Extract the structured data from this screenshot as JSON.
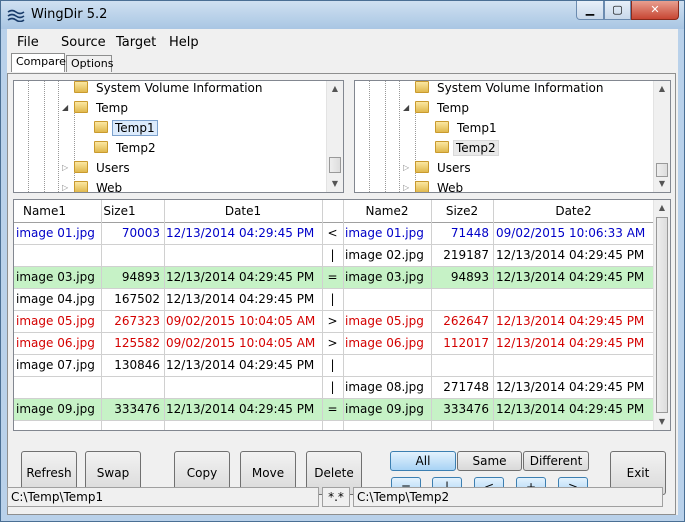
{
  "window": {
    "title": "WingDir 5.2"
  },
  "menu": [
    "File",
    "Source",
    "Target",
    "Help"
  ],
  "tabs": {
    "compare": "Compare",
    "options": "Options"
  },
  "tree_left": {
    "items": [
      {
        "label": "System Volume Information"
      },
      {
        "label": "Temp"
      },
      {
        "label": "Temp1",
        "selected": true
      },
      {
        "label": "Temp2"
      },
      {
        "label": "Users"
      },
      {
        "label": "Web"
      }
    ]
  },
  "tree_right": {
    "items": [
      {
        "label": "System Volume Information"
      },
      {
        "label": "Temp"
      },
      {
        "label": "Temp1"
      },
      {
        "label": "Temp2",
        "selected": true
      },
      {
        "label": "Users"
      },
      {
        "label": "Web"
      }
    ]
  },
  "grid": {
    "headers": {
      "name1": "Name1",
      "size1": "Size1",
      "date1": "Date1",
      "name2": "Name2",
      "size2": "Size2",
      "date2": "Date2"
    },
    "rows": [
      {
        "name1": "image 01.jpg",
        "size1": "70003",
        "date1": "12/13/2014 04:29:45 PM",
        "op": "<",
        "name2": "image 01.jpg",
        "size2": "71448",
        "date2": "09/02/2015 10:06:33 AM",
        "style": "blue"
      },
      {
        "name1": "",
        "size1": "",
        "date1": "",
        "op": "|",
        "name2": "image 02.jpg",
        "size2": "219187",
        "date2": "12/13/2014 04:29:45 PM",
        "style": "black"
      },
      {
        "name1": "image 03.jpg",
        "size1": "94893",
        "date1": "12/13/2014 04:29:45 PM",
        "op": "=",
        "name2": "image 03.jpg",
        "size2": "94893",
        "date2": "12/13/2014 04:29:45 PM",
        "style": "green"
      },
      {
        "name1": "image 04.jpg",
        "size1": "167502",
        "date1": "12/13/2014 04:29:45 PM",
        "op": "|",
        "name2": "",
        "size2": "",
        "date2": "",
        "style": "black"
      },
      {
        "name1": "image 05.jpg",
        "size1": "267323",
        "date1": "09/02/2015 10:04:05 AM",
        "op": ">",
        "name2": "image 05.jpg",
        "size2": "262647",
        "date2": "12/13/2014 04:29:45 PM",
        "style": "red"
      },
      {
        "name1": "image 06.jpg",
        "size1": "125582",
        "date1": "09/02/2015 10:04:05 AM",
        "op": ">",
        "name2": "image 06.jpg",
        "size2": "112017",
        "date2": "12/13/2014 04:29:45 PM",
        "style": "red"
      },
      {
        "name1": "image 07.jpg",
        "size1": "130846",
        "date1": "12/13/2014 04:29:45 PM",
        "op": "|",
        "name2": "",
        "size2": "",
        "date2": "",
        "style": "black"
      },
      {
        "name1": "",
        "size1": "",
        "date1": "",
        "op": "|",
        "name2": "image 08.jpg",
        "size2": "271748",
        "date2": "12/13/2014 04:29:45 PM",
        "style": "black"
      },
      {
        "name1": "image 09.jpg",
        "size1": "333476",
        "date1": "12/13/2014 04:29:45 PM",
        "op": "=",
        "name2": "image 09.jpg",
        "size2": "333476",
        "date2": "12/13/2014 04:29:45 PM",
        "style": "green"
      }
    ]
  },
  "buttons": {
    "refresh": "Refresh",
    "swap": "Swap",
    "copy": "Copy",
    "move": "Move",
    "delete": "Delete",
    "exit": "Exit"
  },
  "filters": {
    "all": "All",
    "same": "Same",
    "different": "Different",
    "eq": "=",
    "bar": "|",
    "lt": "<",
    "plus": "+",
    "gt": ">"
  },
  "status": {
    "left_path": "C:\\Temp\\Temp1",
    "mask": "*.*",
    "right_path": "C:\\Temp\\Temp2"
  },
  "colors": {
    "green_row": "#c6f2c6",
    "blue_text": "#0000c8",
    "red_text": "#d40000"
  }
}
